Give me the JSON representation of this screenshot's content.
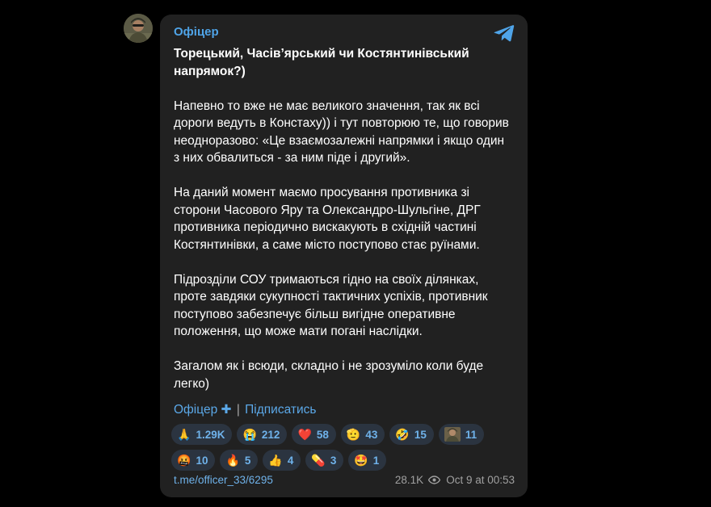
{
  "channel": {
    "name": "Офіцер"
  },
  "post": {
    "title": "Торецький, Часівʼярський чи Костянтинівський напрямок?)",
    "paragraphs": [
      "Напевно то вже не має великого значення, так як всі дороги ведуть в Констаху)) і тут повторюю те, що говорив неодноразово: «Це взаємозалежні напрямки і якщо один з них обвалиться - за ним піде і другий».",
      "На даний момент маємо просування противника зі сторони Часового Яру та Олександро-Шульгіне, ДРГ противника періодично вискакують в східній частині Костянтинівки, а саме місто поступово стає руїнами.",
      "Підрозділи СОУ тримаються гідно на своїх ділянках, проте завдяки сукупності тактичних успіхів, противник поступово забезпечує більш вигідне оперативне положення, що може мати погані наслідки.",
      "Загалом як і всюди, складно і не зрозуміло коли буде легко)"
    ],
    "footer": {
      "channel_link": "Офіцер ✚",
      "separator": "|",
      "subscribe": "Підписатись"
    }
  },
  "reactions": [
    {
      "emoji": "🙏",
      "icon": "folded-hands",
      "count": "1.29K"
    },
    {
      "emoji": "😭",
      "icon": "loudly-crying-face",
      "count": "212"
    },
    {
      "emoji": "❤️",
      "icon": "red-heart",
      "count": "58"
    },
    {
      "emoji": "🫡",
      "icon": "saluting-face",
      "count": "43"
    },
    {
      "emoji": "🤣",
      "icon": "rolling-laughing-face",
      "count": "15"
    },
    {
      "emoji": "",
      "icon": "custom-soldier-emoji",
      "count": "11"
    },
    {
      "emoji": "🤬",
      "icon": "cursing-face",
      "count": "10"
    },
    {
      "emoji": "🔥",
      "icon": "fire",
      "count": "5"
    },
    {
      "emoji": "👍",
      "icon": "thumbs-up",
      "count": "4"
    },
    {
      "emoji": "💊",
      "icon": "pill",
      "count": "3"
    },
    {
      "emoji": "🤩",
      "icon": "star-struck",
      "count": "1"
    }
  ],
  "meta": {
    "post_link": "t.me/officer_33/6295",
    "views": "28.1K",
    "date": "Oct 9 at 00:53"
  },
  "colors": {
    "card": "#212121",
    "accent": "#4fa4e8",
    "reaction_bg": "#2b3440",
    "background": "#000000"
  }
}
